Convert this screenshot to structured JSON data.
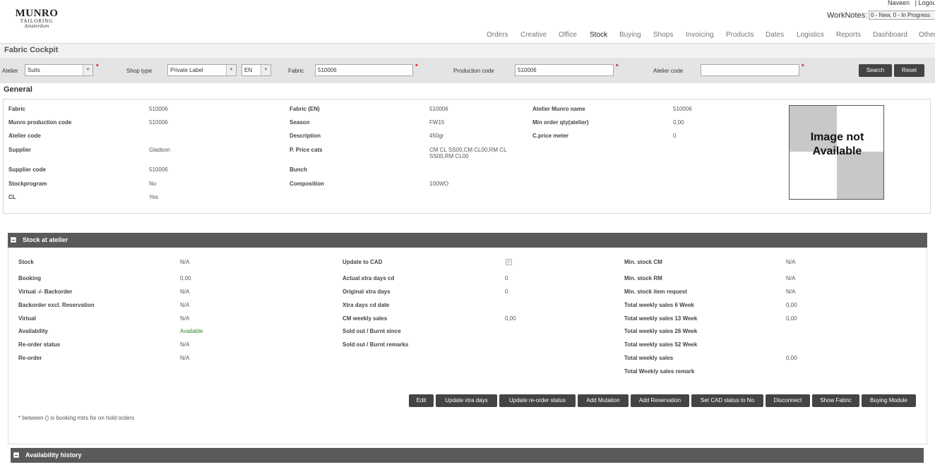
{
  "header": {
    "logo": {
      "line1": "MUNRO",
      "line2": "TAILORING",
      "line3": "Amsterdam"
    },
    "user": "Naveen",
    "logout": "| Logout",
    "worknotes_label": "WorkNotes:",
    "worknotes_value": "0 - New, 0 - In Progress"
  },
  "nav": {
    "items": [
      "Orders",
      "Creative",
      "Office",
      "Stock",
      "Buying",
      "Shops",
      "Invoicing",
      "Products",
      "Dates",
      "Logistics",
      "Reports",
      "Dashboard",
      "Other"
    ],
    "active": "Stock"
  },
  "page": {
    "title": "Fabric Cockpit"
  },
  "search": {
    "atelier_label": "Atelier",
    "atelier_value": "Suits",
    "shop_type_label": "Shop type",
    "shop_type_value": "Private Label",
    "lang_value": "EN",
    "fabric_label": "Fabric",
    "fabric_value": "510006",
    "production_code_label": "Production code",
    "production_code_value": "510006",
    "atelier_code_label": "Atelier code",
    "atelier_code_value": "",
    "required_mark": "*",
    "search_button": "Search",
    "reset_button": "Reset"
  },
  "general": {
    "title": "General",
    "fields": [
      {
        "label": "Fabric",
        "value": "510006"
      },
      {
        "label": "Munro production code",
        "value": "510006"
      },
      {
        "label": "Atelier code",
        "value": ""
      },
      {
        "label": "Supplier",
        "value": "Gladson"
      },
      {
        "label": "Supplier code",
        "value": "510006"
      },
      {
        "label": "Stockprogram",
        "value": "No"
      },
      {
        "label": "CL",
        "value": "Yes"
      },
      {
        "label": "Fabric (EN)",
        "value": "510006"
      },
      {
        "label": "Season",
        "value": "FW15"
      },
      {
        "label": "Description",
        "value": "450gr"
      },
      {
        "label": "P. Price cats",
        "value": "CM CL SS00,CM CL00,RM CL SS00,RM CL00"
      },
      {
        "label": "Bunch",
        "value": ""
      },
      {
        "label": "Composition",
        "value": "100WO"
      },
      {
        "label": "Atelier Munro name",
        "value": "510006"
      },
      {
        "label": "Min order qty(atelier)",
        "value": "0,00"
      },
      {
        "label": "C.price meter",
        "value": "0"
      }
    ],
    "image_text": "Image not Available"
  },
  "stock": {
    "title": "Stock at atelier",
    "col1": [
      {
        "label": "Stock",
        "value": "N/A"
      },
      {
        "label": "Booking",
        "value": "0,00"
      },
      {
        "label": "Virtual -/- Backorder",
        "value": "N/A"
      },
      {
        "label": "Backorder excl. Reservation",
        "value": "N/A"
      },
      {
        "label": "Virtual",
        "value": "N/A"
      },
      {
        "label": "Availability",
        "value": "Available"
      },
      {
        "label": "Re-order status",
        "value": "N/A"
      },
      {
        "label": "Re-order",
        "value": "N/A"
      }
    ],
    "col2": [
      {
        "label": "Update to CAD",
        "value": "✓"
      },
      {
        "label": "Actual xtra days cd",
        "value": "0"
      },
      {
        "label": "Original xtra days",
        "value": "0"
      },
      {
        "label": "Xtra days cd date",
        "value": ""
      },
      {
        "label": "CM weekly sales",
        "value": "0,00"
      },
      {
        "label": "Sold out / Burnt since",
        "value": ""
      },
      {
        "label": "Sold out / Burnt remarks",
        "value": ""
      }
    ],
    "col3": [
      {
        "label": "Min. stock CM",
        "value": "N/A"
      },
      {
        "label": "Min. stock RM",
        "value": "N/A"
      },
      {
        "label": "Min. stock item request",
        "value": "N/A"
      },
      {
        "label": "Total weekly sales 6 Week",
        "value": "0,00"
      },
      {
        "label": "Total weekly sales 13 Week",
        "value": "0,00"
      },
      {
        "label": "Total weekly sales 26 Week",
        "value": ""
      },
      {
        "label": "Total weekly sales 52 Week",
        "value": ""
      },
      {
        "label": "Total weekly sales",
        "value": "0,00"
      },
      {
        "label": "Total Weekly sales remark",
        "value": ""
      }
    ],
    "buttons": [
      "Edit",
      "Update xtra days",
      "Update re-order status",
      "Add Mutation",
      "Add Reservation",
      "Set CAD status to No",
      "Disconnect",
      "Show Fabric",
      "Buying Module"
    ],
    "note": "* between () is booking mtrs for on hold orders"
  },
  "history": {
    "title": "Availability history"
  },
  "colors": {
    "header_bar": "#5a5a5a",
    "button": "#444444",
    "available": "#2e8b2e",
    "required": "#dd0000"
  }
}
